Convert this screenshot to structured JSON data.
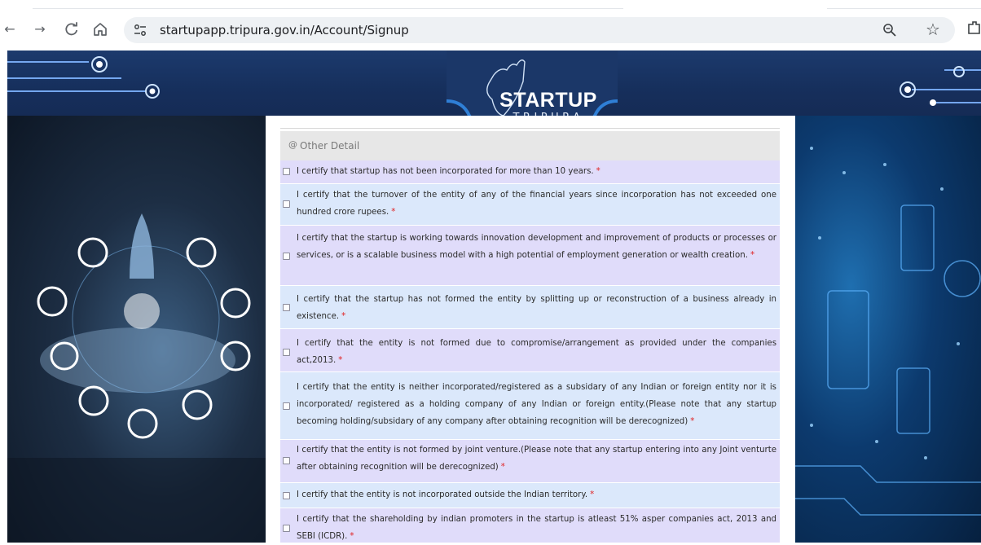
{
  "browser": {
    "url": "startupapp.tripura.gov.in/Account/Signup",
    "back_icon": "arrow-left-icon",
    "forward_icon": "arrow-right-icon",
    "reload_icon": "reload-icon",
    "home_icon": "home-icon"
  },
  "header": {
    "logo_title": "STARTUP",
    "logo_subtitle": "TRIPURA"
  },
  "form": {
    "section_title": "Other Detail",
    "required_mark": "*",
    "declarations": [
      "I certify that startup has not been incorporated for more than 10 years.",
      "I certify that the turnover of the entity of any of the financial years since incorporation has not exceeded one hundred crore rupees.",
      "I certify that the startup is working towards innovation development and improvement of products or processes or services, or is a scalable business model with a high potential of employment generation or wealth creation.",
      "I certify that the startup has not formed the entity by splitting up or reconstruction of a business already in existence.",
      "I certify that the entity is not formed due to compromise/arrangement as provided under the companies act,2013.",
      "I certify that the entity is neither incorporated/registered as a subsidary of any Indian or foreign entity nor it is incorporated/ registered as a holding company of any Indian or foreign entity.(Please note that any startup becoming holding/subsidary of any company after obtaining recognition will be derecognized)",
      "I certify that the entity is not formed by joint venture.(Please note that any startup entering into any Joint venturte after obtaining recognition will be derecognized)",
      "I certify that the entity is not incorporated outside the Indian territory.",
      "I certify that the shareholding by indian promoters in the startup is atleast 51% asper companies act, 2013 and SEBI (ICDR)."
    ]
  },
  "colors": {
    "banner": "#1c3a6d",
    "row_lavender": "#e0dcfa",
    "row_blue": "#dbe8fb",
    "required": "#e02020"
  }
}
